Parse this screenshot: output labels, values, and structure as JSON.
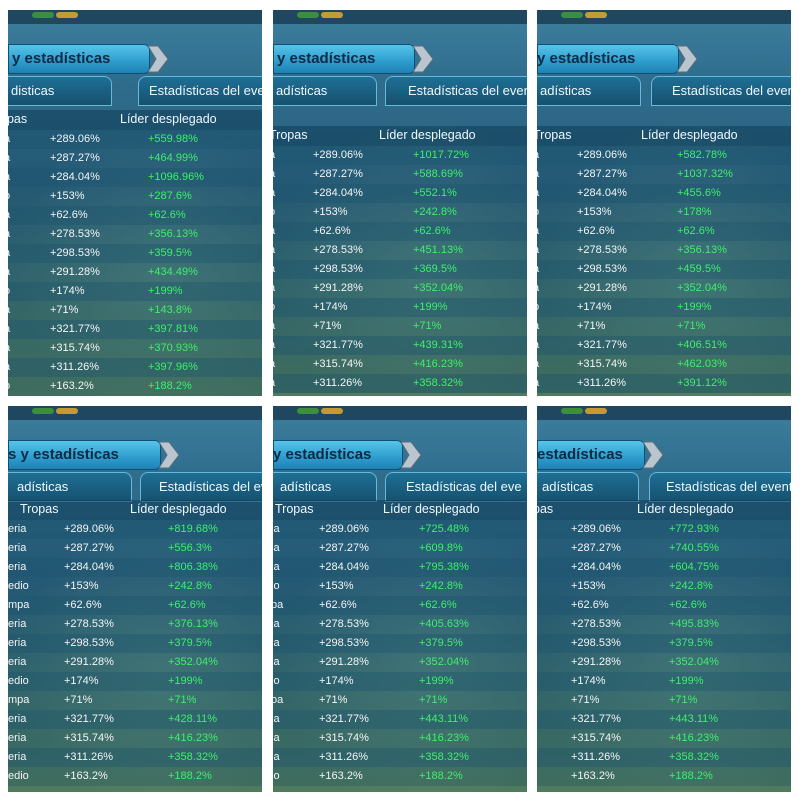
{
  "colors": {
    "banner": "#2f9fd0",
    "leader_value": "#3ef06a",
    "text": "#f5f5f5"
  },
  "panels": [
    {
      "banner_title": "y estadísticas",
      "tab_left": "disticas",
      "tab_right": "Estadísticas del even",
      "header_troops": "opas",
      "header_leader": "Líder desplegado",
      "rows": [
        {
          "name": "a",
          "troops": "+289.06%",
          "leader": "+559.98%"
        },
        {
          "name": "a",
          "troops": "+287.27%",
          "leader": "+464.99%"
        },
        {
          "name": "a",
          "troops": "+284.04%",
          "leader": "+1096.96%"
        },
        {
          "name": "o",
          "troops": "+153%",
          "leader": "+287.6%"
        },
        {
          "name": "a",
          "troops": "+62.6%",
          "leader": "+62.6%"
        },
        {
          "name": "a",
          "troops": "+278.53%",
          "leader": "+356.13%"
        },
        {
          "name": "a",
          "troops": "+298.53%",
          "leader": "+359.5%"
        },
        {
          "name": "a",
          "troops": "+291.28%",
          "leader": "+434.49%"
        },
        {
          "name": "o",
          "troops": "+174%",
          "leader": "+199%"
        },
        {
          "name": "a",
          "troops": "+71%",
          "leader": "+143.8%"
        },
        {
          "name": "a",
          "troops": "+321.77%",
          "leader": "+397.81%"
        },
        {
          "name": "a",
          "troops": "+315.74%",
          "leader": "+370.93%"
        },
        {
          "name": "a",
          "troops": "+311.26%",
          "leader": "+397.96%"
        },
        {
          "name": "o",
          "troops": "+163.2%",
          "leader": "+188.2%"
        }
      ]
    },
    {
      "banner_title": "y estadísticas",
      "tab_left": "adísticas",
      "tab_right": "Estadísticas del even",
      "header_troops": "Tropas",
      "header_leader": "Líder desplegado",
      "rows": [
        {
          "name": "a",
          "troops": "+289.06%",
          "leader": "+1017.72%"
        },
        {
          "name": "a",
          "troops": "+287.27%",
          "leader": "+588.69%"
        },
        {
          "name": "a",
          "troops": "+284.04%",
          "leader": "+552.1%"
        },
        {
          "name": "o",
          "troops": "+153%",
          "leader": "+242.8%"
        },
        {
          "name": "a",
          "troops": "+62.6%",
          "leader": "+62.6%"
        },
        {
          "name": "a",
          "troops": "+278.53%",
          "leader": "+451.13%"
        },
        {
          "name": "a",
          "troops": "+298.53%",
          "leader": "+369.5%"
        },
        {
          "name": "a",
          "troops": "+291.28%",
          "leader": "+352.04%"
        },
        {
          "name": "o",
          "troops": "+174%",
          "leader": "+199%"
        },
        {
          "name": "a",
          "troops": "+71%",
          "leader": "+71%"
        },
        {
          "name": "a",
          "troops": "+321.77%",
          "leader": "+439.31%"
        },
        {
          "name": "a",
          "troops": "+315.74%",
          "leader": "+416.23%"
        },
        {
          "name": "a",
          "troops": "+311.26%",
          "leader": "+358.32%"
        }
      ]
    },
    {
      "banner_title": "y estadísticas",
      "tab_left": "adísticas",
      "tab_right": "Estadísticas del even",
      "header_troops": "Tropas",
      "header_leader": "Líder desplegado",
      "rows": [
        {
          "name": "a",
          "troops": "+289.06%",
          "leader": "+582.78%"
        },
        {
          "name": "a",
          "troops": "+287.27%",
          "leader": "+1037.32%"
        },
        {
          "name": "a",
          "troops": "+284.04%",
          "leader": "+455.6%"
        },
        {
          "name": "o",
          "troops": "+153%",
          "leader": "+178%"
        },
        {
          "name": "a",
          "troops": "+62.6%",
          "leader": "+62.6%"
        },
        {
          "name": "a",
          "troops": "+278.53%",
          "leader": "+356.13%"
        },
        {
          "name": "a",
          "troops": "+298.53%",
          "leader": "+459.5%"
        },
        {
          "name": "a",
          "troops": "+291.28%",
          "leader": "+352.04%"
        },
        {
          "name": "o",
          "troops": "+174%",
          "leader": "+199%"
        },
        {
          "name": "a",
          "troops": "+71%",
          "leader": "+71%"
        },
        {
          "name": "a",
          "troops": "+321.77%",
          "leader": "+406.51%"
        },
        {
          "name": "a",
          "troops": "+315.74%",
          "leader": "+462.03%"
        },
        {
          "name": "a",
          "troops": "+311.26%",
          "leader": "+391.12%"
        }
      ]
    },
    {
      "banner_title": "s y estadísticas",
      "tab_left": "adísticas",
      "tab_right": "Estadísticas del eve",
      "header_troops": "Tropas",
      "header_leader": "Líder desplegado",
      "rows": [
        {
          "name": "eria",
          "troops": "+289.06%",
          "leader": "+819.68%"
        },
        {
          "name": "eria",
          "troops": "+287.27%",
          "leader": "+556.3%"
        },
        {
          "name": "eria",
          "troops": "+284.04%",
          "leader": "+806.38%"
        },
        {
          "name": "edio",
          "troops": "+153%",
          "leader": "+242.8%"
        },
        {
          "name": "mpa",
          "troops": "+62.6%",
          "leader": "+62.6%"
        },
        {
          "name": "eria",
          "troops": "+278.53%",
          "leader": "+376.13%"
        },
        {
          "name": "eria",
          "troops": "+298.53%",
          "leader": "+379.5%"
        },
        {
          "name": "eria",
          "troops": "+291.28%",
          "leader": "+352.04%"
        },
        {
          "name": "edio",
          "troops": "+174%",
          "leader": "+199%"
        },
        {
          "name": "mpa",
          "troops": "+71%",
          "leader": "+71%"
        },
        {
          "name": "eria",
          "troops": "+321.77%",
          "leader": "+428.11%"
        },
        {
          "name": "eria",
          "troops": "+315.74%",
          "leader": "+416.23%"
        },
        {
          "name": "eria",
          "troops": "+311.26%",
          "leader": "+358.32%"
        },
        {
          "name": "edio",
          "troops": "+163.2%",
          "leader": "+188.2%"
        }
      ]
    },
    {
      "banner_title": "y estadísticas",
      "tab_left": "adísticas",
      "tab_right": "Estadísticas del eve",
      "header_troops": "Tropas",
      "header_leader": "Líder desplegado",
      "rows": [
        {
          "name": "ia",
          "troops": "+289.06%",
          "leader": "+725.48%"
        },
        {
          "name": "ia",
          "troops": "+287.27%",
          "leader": "+609.8%"
        },
        {
          "name": "ia",
          "troops": "+284.04%",
          "leader": "+795.38%"
        },
        {
          "name": "io",
          "troops": "+153%",
          "leader": "+242.8%"
        },
        {
          "name": "pa",
          "troops": "+62.6%",
          "leader": "+62.6%"
        },
        {
          "name": "ia",
          "troops": "+278.53%",
          "leader": "+405.63%"
        },
        {
          "name": "ia",
          "troops": "+298.53%",
          "leader": "+379.5%"
        },
        {
          "name": "ia",
          "troops": "+291.28%",
          "leader": "+352.04%"
        },
        {
          "name": "io",
          "troops": "+174%",
          "leader": "+199%"
        },
        {
          "name": "oa",
          "troops": "+71%",
          "leader": "+71%"
        },
        {
          "name": "ia",
          "troops": "+321.77%",
          "leader": "+443.11%"
        },
        {
          "name": "ia",
          "troops": "+315.74%",
          "leader": "+416.23%"
        },
        {
          "name": "ia",
          "troops": "+311.26%",
          "leader": "+358.32%"
        },
        {
          "name": "io",
          "troops": "+163.2%",
          "leader": "+188.2%"
        }
      ]
    },
    {
      "banner_title": "estadísticas",
      "tab_left": "adísticas",
      "tab_right": "Estadísticas del event",
      "header_troops": "pas",
      "header_leader": "Líder desplegado",
      "rows": [
        {
          "name": "",
          "troops": "+289.06%",
          "leader": "+772.93%"
        },
        {
          "name": "",
          "troops": "+287.27%",
          "leader": "+740.55%"
        },
        {
          "name": "",
          "troops": "+284.04%",
          "leader": "+604.75%"
        },
        {
          "name": "",
          "troops": "+153%",
          "leader": "+242.8%"
        },
        {
          "name": "",
          "troops": "+62.6%",
          "leader": "+62.6%"
        },
        {
          "name": "",
          "troops": "+278.53%",
          "leader": "+495.83%"
        },
        {
          "name": "",
          "troops": "+298.53%",
          "leader": "+379.5%"
        },
        {
          "name": "",
          "troops": "+291.28%",
          "leader": "+352.04%"
        },
        {
          "name": "",
          "troops": "+174%",
          "leader": "+199%"
        },
        {
          "name": "",
          "troops": "+71%",
          "leader": "+71%"
        },
        {
          "name": "",
          "troops": "+321.77%",
          "leader": "+443.11%"
        },
        {
          "name": "",
          "troops": "+315.74%",
          "leader": "+416.23%"
        },
        {
          "name": "",
          "troops": "+311.26%",
          "leader": "+358.32%"
        },
        {
          "name": "",
          "troops": "+163.2%",
          "leader": "+188.2%"
        }
      ]
    }
  ]
}
